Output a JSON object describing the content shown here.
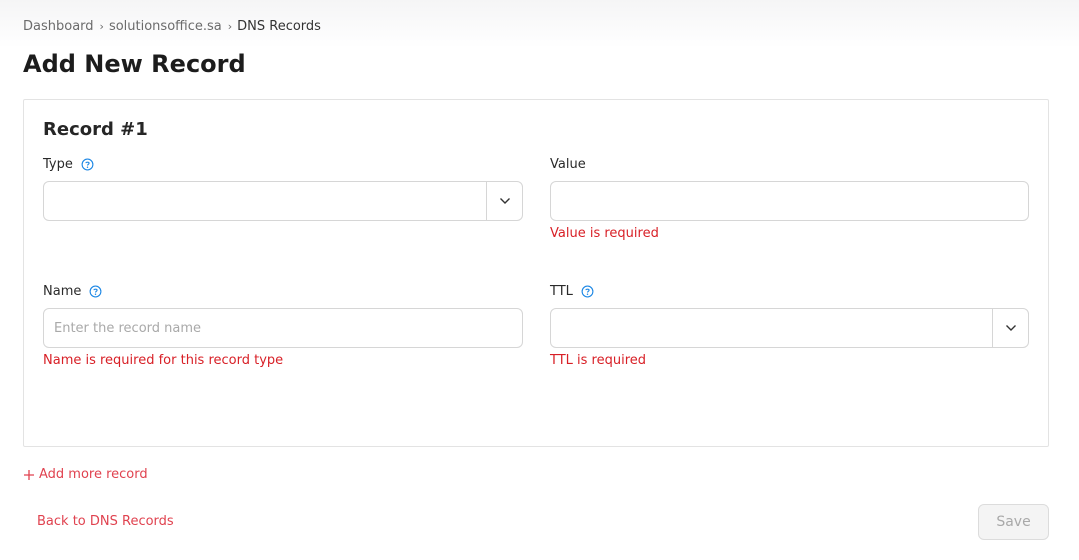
{
  "breadcrumb": {
    "items": [
      "Dashboard",
      "solutionsoffice.sa"
    ],
    "current": "DNS Records"
  },
  "page_title": "Add New Record",
  "record": {
    "title": "Record #1",
    "type": {
      "label": "Type",
      "value": ""
    },
    "value": {
      "label": "Value",
      "value": "",
      "error": "Value is required"
    },
    "name": {
      "label": "Name",
      "placeholder": "Enter the record name",
      "value": "",
      "error": "Name is required for this record type"
    },
    "ttl": {
      "label": "TTL",
      "value": "",
      "error": "TTL is required"
    }
  },
  "actions": {
    "add_more": "Add more record",
    "back": "Back to DNS Records",
    "save": "Save"
  },
  "colors": {
    "accent": "#e0424f",
    "error": "#d81f26",
    "help_icon": "#1e88e5"
  }
}
